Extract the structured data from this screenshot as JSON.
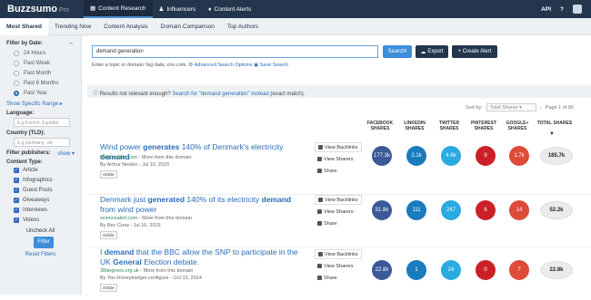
{
  "top": {
    "brand": "Buzzsumo",
    "brand_suffix": "Pro",
    "nav": [
      {
        "label": "Content Research",
        "icon": "grid-icon"
      },
      {
        "label": "Influencers",
        "icon": "people-icon"
      },
      {
        "label": "Content Alerts",
        "icon": "bell-icon"
      }
    ],
    "api": "API",
    "help": "?"
  },
  "subnav": [
    "Most Shared",
    "Trending Now",
    "Content Analysis",
    "Domain Comparison",
    "Top Authors"
  ],
  "sidebar": {
    "filter_title": "Filter by Date:",
    "collapse_icon": "arrow-left-icon",
    "dates": [
      "24 Hours",
      "Past Week",
      "Past Month",
      "Past 6 Months",
      "Past Year"
    ],
    "selected_date": "Past Year",
    "specific_range": "Show Specific Range ▸",
    "language_label": "Language:",
    "language_placeholder": "E.g French, Español",
    "country_label": "Country (TLD):",
    "country_placeholder": "E.g Germany, .de",
    "publisher_label": "Filter publishers:",
    "publisher_show": "show ▾",
    "content_type_label": "Content Type:",
    "content_types": [
      "Article",
      "Infographics",
      "Guest Posts",
      "Giveaways",
      "Interviews",
      "Videos"
    ],
    "uncheck_all": "Uncheck All",
    "filter_button": "Filter",
    "reset": "Reset Filters"
  },
  "search": {
    "value": "demand generation",
    "search_button": "Search!",
    "export_button": "Export",
    "alert_button": "+ Create Alert",
    "hint": "Enter a topic or domain: big data, cnn.com.",
    "advanced": "Advanced Search Options",
    "save": "Save Search"
  },
  "notice": {
    "prefix": "Results not relevant enough? ",
    "link": "Search for \"demand generation\" instead",
    "suffix": " (exact match)."
  },
  "sort": {
    "label": "Sort by:",
    "value": "Total Shares",
    "page": "Page 1 of 85"
  },
  "columns": [
    "FACEBOOK SHARES",
    "LINKEDIN SHARES",
    "TWITTER SHARES",
    "PINTEREST SHARES",
    "GOOGLE+ SHARES",
    "TOTAL SHARES"
  ],
  "colors": {
    "facebook": "#3b5998",
    "linkedin": "#1a7bbd",
    "twitter": "#29aae1",
    "pinterest": "#cb2027",
    "google": "#dd4b39"
  },
  "actions": {
    "backlinks": "View Backlinks",
    "sharers": "View Sharers",
    "share": "Share"
  },
  "results": [
    {
      "title_parts": [
        "Wind power ",
        "generates",
        " 140% of Denmark's electricity ",
        "demand",
        ""
      ],
      "url": "theguardian.com",
      "more": " - More from this domain",
      "by": "By Arthur Neslen - Jul 10, 2015",
      "tag": "Article",
      "facebook": "177.3k",
      "linkedin": "2.1k",
      "twitter": "4.6k",
      "pinterest": "9",
      "google": "1.7k",
      "total": "185.7k"
    },
    {
      "title_parts": [
        "Denmark just ",
        "generated",
        " 140% of its electricity ",
        "demand",
        " from wind power"
      ],
      "url": "sciencealert.com",
      "more": " - More from this domain",
      "by": "By Bec Crew - Jul 16, 2015",
      "tag": "Article",
      "facebook": "51.8k",
      "linkedin": "111",
      "twitter": "247",
      "pinterest": "6",
      "google": "14",
      "total": "52.2k"
    },
    {
      "title_parts": [
        "I ",
        "demand",
        " that the BBC allow the SNP to participate in the UK ",
        "General",
        " Election debate."
      ],
      "url": "38degrees.org.uk",
      "more": " - More from this domain",
      "by": "By You Honeybadger.configure - Oct 13, 2014",
      "tag": "Article",
      "facebook": "22.8k",
      "linkedin": "1",
      "twitter": "24",
      "pinterest": "0",
      "google": "7",
      "total": "22.8k"
    }
  ]
}
